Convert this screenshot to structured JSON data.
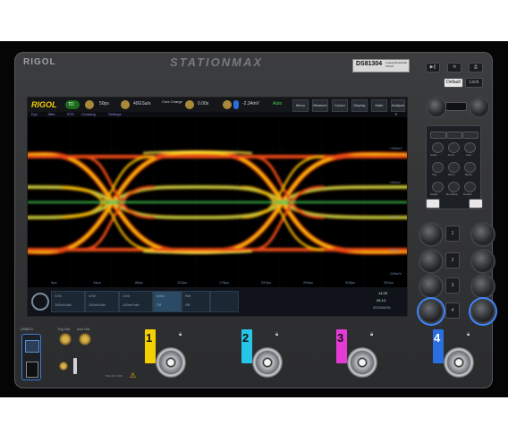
{
  "device": {
    "brand": "RIGOL",
    "series": "STATIONMAX",
    "model": "DS81304",
    "model_sub": "Analog Bandwidth 13GHz",
    "hw_buttons": [
      "▶||",
      "⟲",
      "⎙",
      "Default",
      "Lock"
    ]
  },
  "toolbar": {
    "logo": "RIGOL",
    "mode": "TD",
    "timebase": "50ps",
    "sample": "40GSa/s",
    "acq": "Core Charge",
    "delay": "0.00s",
    "trigger_level": "-2.34mV",
    "auto": "Auto",
    "icons": [
      "Menu",
      "Measure",
      "Cursor",
      "Display",
      "Math",
      "Analyze"
    ]
  },
  "submenu": [
    "Eye",
    "Jitter",
    "RTE",
    "Crossing",
    "Settings"
  ],
  "eye": {
    "x_ticks": [
      "0ps",
      "44ps",
      "88ps",
      "132ps",
      "176ps",
      "220ps",
      "264ps",
      "308ps",
      "352ps"
    ],
    "y_ticks": [
      "+180mV",
      "+90mV",
      "0mV",
      "-90mV",
      "-180mV"
    ]
  },
  "bottom": {
    "tiles": [
      {
        "name": "CH1",
        "value": "100mV/div"
      },
      {
        "name": "CH2",
        "value": "100mV/div"
      },
      {
        "name": "CH3",
        "value": "100mV/div"
      },
      {
        "name": "Math",
        "value": "Off"
      },
      {
        "name": "Ref",
        "value": "Off"
      }
    ],
    "time": "2023/06/01",
    "clock": "14:25",
    "temp": "26.1C"
  },
  "right_panel": {
    "labels": [
      "Quick",
      "Navigate",
      "Position",
      "Scale",
      "Horiz",
      "Auto",
      "Trig",
      "Menu",
      "Mode",
      "Single",
      "Run/Stop",
      "Default"
    ],
    "knob_labels": [
      "1",
      "2",
      "3",
      "4"
    ]
  },
  "front": {
    "usb": "USB3.0",
    "aux": [
      "Trig Out",
      "Aux Out"
    ],
    "warning": "⚠",
    "spec": "50Ω ≤5V RMS",
    "channels": [
      {
        "n": "1",
        "color": "#f4d000"
      },
      {
        "n": "2",
        "color": "#27c6e8"
      },
      {
        "n": "3",
        "color": "#e43bd6"
      },
      {
        "n": "4",
        "color": "#2a6fe0"
      }
    ]
  }
}
